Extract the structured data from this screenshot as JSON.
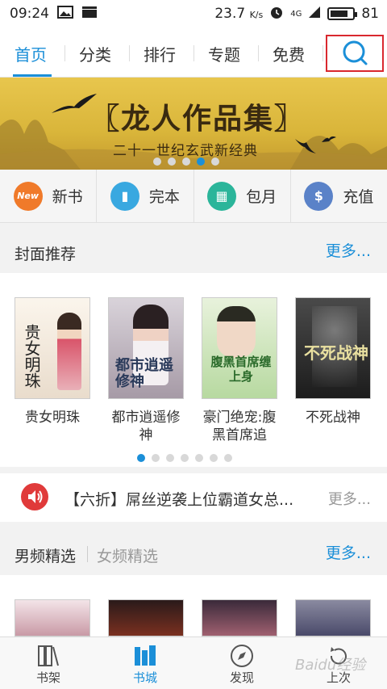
{
  "status_bar": {
    "time": "09:24",
    "speed": "23.7",
    "speed_unit": "K/s",
    "network": "4G",
    "battery": "81",
    "battery_level": 0.81,
    "icons": [
      "image-icon",
      "clapper-icon",
      "alarm-icon",
      "signal-icon",
      "battery-icon"
    ]
  },
  "top_nav": {
    "tabs": [
      {
        "label": "首页",
        "active": true
      },
      {
        "label": "分类",
        "active": false
      },
      {
        "label": "排行",
        "active": false
      },
      {
        "label": "专题",
        "active": false
      },
      {
        "label": "免费",
        "active": false
      }
    ],
    "search_icon": "search-icon",
    "accent_color": "#1b8fd8",
    "highlight_color": "#d9282f"
  },
  "banner": {
    "title": "〖龙人作品集〗",
    "subtitle": "二十一世纪玄武新经典",
    "slide_count": 5,
    "active_slide": 4
  },
  "categories": [
    {
      "label": "新书",
      "icon": "new-badge-icon",
      "color": "#f07a2a",
      "glyph": "New"
    },
    {
      "label": "完本",
      "icon": "book-icon",
      "color": "#39a8e0",
      "glyph": "▮"
    },
    {
      "label": "包月",
      "icon": "calendar-icon",
      "color": "#2bb59a",
      "glyph": "▦"
    },
    {
      "label": "充值",
      "icon": "dollar-icon",
      "color": "#5a82c8",
      "glyph": "$"
    }
  ],
  "cover_section": {
    "title": "封面推荐",
    "more": "更多...",
    "books": [
      {
        "title": "贵女明珠",
        "cover_text": "贵女明珠"
      },
      {
        "title": "都市逍遥修神",
        "cover_text": "都市逍遥修神"
      },
      {
        "title": "豪门绝宠:腹黑首席追",
        "cover_text": "腹黑首席缠上身"
      },
      {
        "title": "不死战神",
        "cover_text": "不死战神"
      }
    ],
    "page_count": 7,
    "active_page": 1
  },
  "promo": {
    "text": "【六折】屌丝逆袭上位霸道女总...",
    "more": "更多...",
    "icon": "speaker-icon"
  },
  "gender_section": {
    "active_tab": "男频精选",
    "other_tab": "女频精选",
    "more": "更多..."
  },
  "bottom_nav": [
    {
      "label": "书架",
      "icon": "bookshelf-icon",
      "active": false
    },
    {
      "label": "书城",
      "icon": "bookstore-icon",
      "active": true
    },
    {
      "label": "发现",
      "icon": "compass-icon",
      "active": false
    },
    {
      "label": "上次",
      "icon": "history-icon",
      "active": false
    }
  ],
  "watermark": "Baidu经验"
}
